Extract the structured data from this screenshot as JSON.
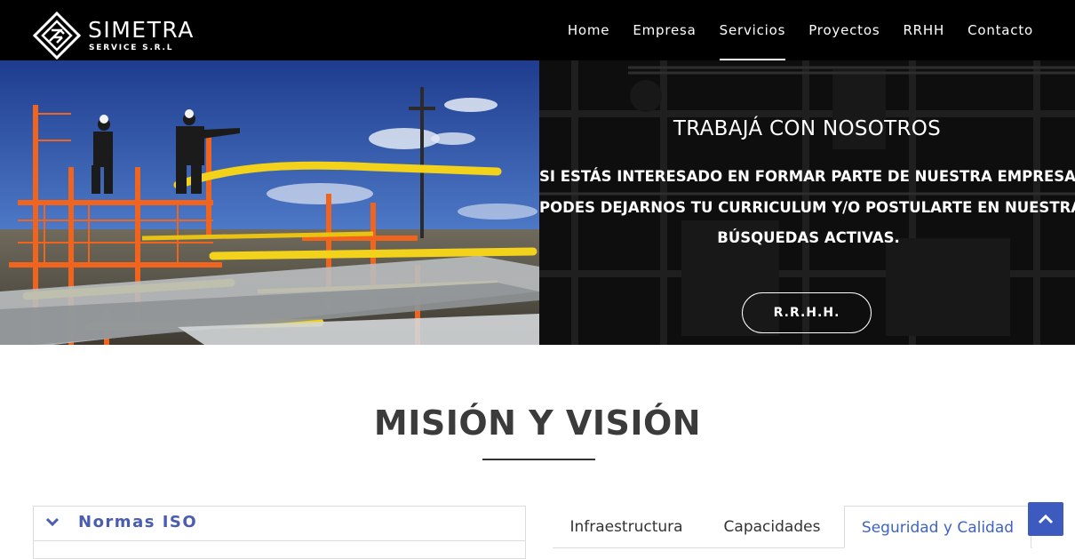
{
  "brand": {
    "name": "SIMETRA",
    "subtitle": "SERVICE S.R.L",
    "logo_icon": "diamond-logo-icon"
  },
  "nav": {
    "items": [
      {
        "label": "Home",
        "active": false
      },
      {
        "label": "Empresa",
        "active": false
      },
      {
        "label": "Servicios",
        "active": true
      },
      {
        "label": "Proyectos",
        "active": false
      },
      {
        "label": "RRHH",
        "active": false
      },
      {
        "label": "Contacto",
        "active": false
      }
    ]
  },
  "hero": {
    "title": "TRABAJÁ CON NOSOTROS",
    "body_lines": [
      "SI ESTÁS INTERESADO EN FORMAR PARTE DE NUESTRA EMPRESA,",
      "PODES DEJARNOS TU CURRICULUM Y/O POSTULARTE EN NUESTRAS",
      "BÚSQUEDAS ACTIVAS."
    ],
    "button_label": "R.R.H.H."
  },
  "section": {
    "title": "MISIÓN Y VISIÓN"
  },
  "accordion": {
    "title": "Normas ISO",
    "icon": "chevron-down-icon"
  },
  "tabs": {
    "items": [
      {
        "label": "Infraestructura",
        "active": false
      },
      {
        "label": "Capacidades",
        "active": false
      },
      {
        "label": "Seguridad y Calidad",
        "active": true
      }
    ]
  },
  "scroll_top": {
    "icon": "chevron-up-icon"
  },
  "colors": {
    "header_bg": "#000000",
    "accent": "#3d5bbf",
    "accordion_title": "#4a5db0",
    "active_tab": "#3f63c4"
  }
}
